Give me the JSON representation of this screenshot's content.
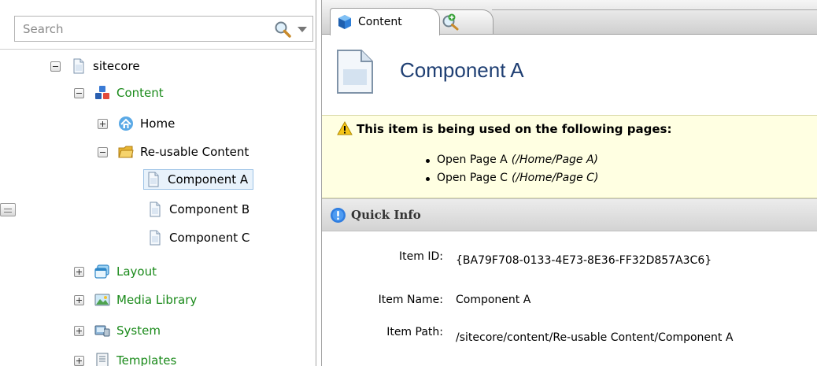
{
  "search": {
    "placeholder": "Search"
  },
  "tree": {
    "root": {
      "label": "sitecore"
    },
    "content": {
      "label": "Content"
    },
    "home": {
      "label": "Home"
    },
    "reusable": {
      "label": "Re-usable Content"
    },
    "component_a": {
      "label": "Component A"
    },
    "component_b": {
      "label": "Component B"
    },
    "component_c": {
      "label": "Component C"
    },
    "layout": {
      "label": "Layout"
    },
    "media_library": {
      "label": "Media Library"
    },
    "system": {
      "label": "System"
    },
    "templates": {
      "label": "Templates"
    }
  },
  "tabs": {
    "content_label": "Content"
  },
  "item": {
    "title": "Component A"
  },
  "warning": {
    "title": "This item is being used on the following pages:",
    "pages": [
      {
        "name": "Open Page A",
        "path": "(/Home/Page A)"
      },
      {
        "name": "Open Page C",
        "path": "(/Home/Page C)"
      }
    ]
  },
  "quick_info": {
    "label": "Quick Info",
    "item_id_label": "Item ID:",
    "item_id_value": "{BA79F708-0133-4E73-8E36-FF32D857A3C6}",
    "item_name_label": "Item Name:",
    "item_name_value": "Component A",
    "item_path_label": "Item Path:",
    "item_path_value": "/sitecore/content/Re-usable Content/Component A"
  },
  "colors": {
    "green_text": "#1a8a1a",
    "title_blue": "#1f3f73",
    "warning_bg": "#ffffe2"
  }
}
